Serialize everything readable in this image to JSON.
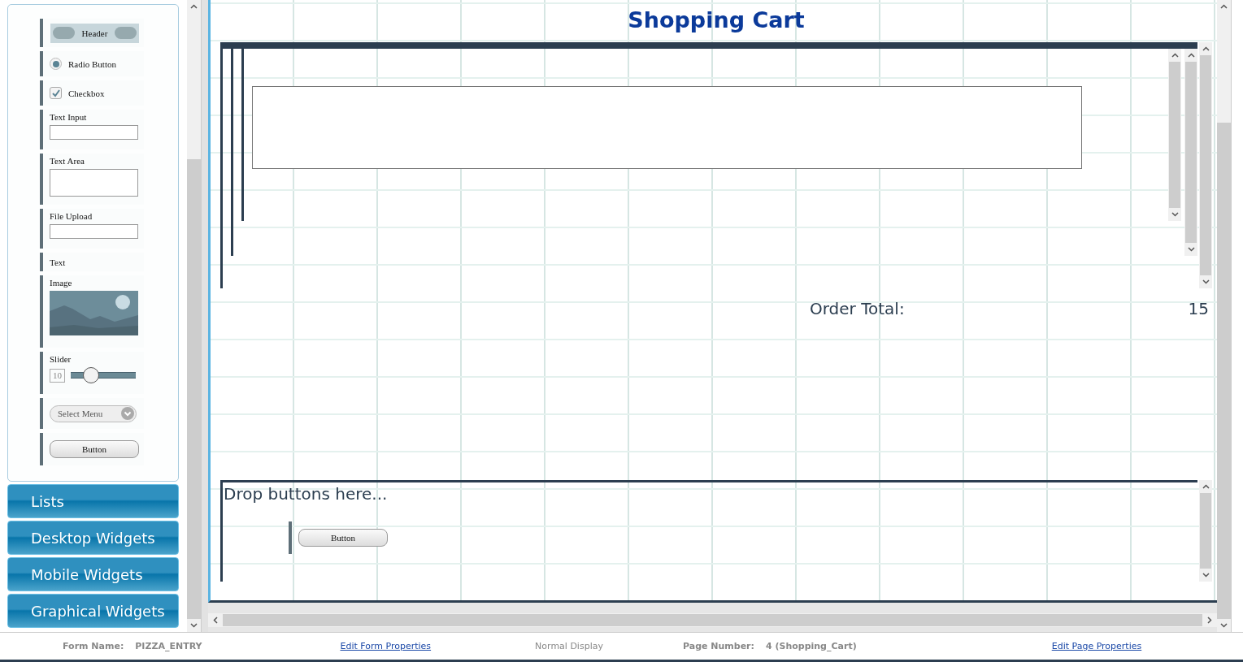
{
  "palette": {
    "items": [
      {
        "kind": "header",
        "label": "Header"
      },
      {
        "kind": "radio",
        "label": "Radio Button",
        "selected": true
      },
      {
        "kind": "checkbox",
        "label": "Checkbox",
        "checked": true
      },
      {
        "kind": "input",
        "label": "Text Input"
      },
      {
        "kind": "textarea",
        "label": "Text Area"
      },
      {
        "kind": "file",
        "label": "File Upload"
      },
      {
        "kind": "text",
        "label": "Text"
      },
      {
        "kind": "image",
        "label": "Image"
      },
      {
        "kind": "slider",
        "label": "Slider",
        "value": "10",
        "level": 0.25
      },
      {
        "kind": "select",
        "label": "Select Menu"
      },
      {
        "kind": "button",
        "label": "Button"
      }
    ]
  },
  "sections": [
    "Lists",
    "Desktop Widgets",
    "Mobile Widgets",
    "Graphical Widgets"
  ],
  "canvas": {
    "title": "Shopping Cart",
    "order_total": {
      "label": "Order Total:",
      "value": "15"
    },
    "drop_zone": {
      "hint": "Drop buttons here...",
      "buttons": [
        "Button"
      ]
    }
  },
  "status_bar": {
    "form_name_label": "Form Name:",
    "form_name": "PIZZA_ENTRY",
    "edit_form_link": "Edit Form Properties",
    "display_mode": "Normal Display",
    "page_number_label": "Page Number:",
    "page_number": "4 (Shopping_Cart)",
    "edit_page_link": "Edit Page Properties"
  }
}
